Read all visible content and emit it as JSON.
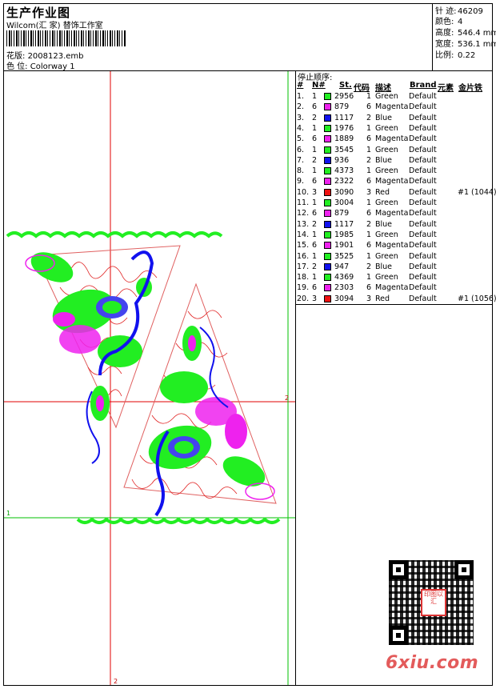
{
  "header": {
    "title": "生产作业图",
    "studio": "Wilcom(汇 家) 替饰工作室",
    "design_label": "花版:",
    "design_value": "2008123.emb",
    "colorway_label": "色 位:",
    "colorway_value": "Colorway 1"
  },
  "stats": [
    {
      "label": "针 迹:",
      "value": "46209"
    },
    {
      "label": "颜色:",
      "value": "4"
    },
    {
      "label": "高度:",
      "value": "546.4 mm"
    },
    {
      "label": "宽度:",
      "value": "536.1 mm"
    },
    {
      "label": "比例:",
      "value": "0.22"
    }
  ],
  "sequence": {
    "title": "停止顺序:",
    "headers": {
      "num": "#",
      "n": "N#",
      "st": "St.",
      "code": "代码",
      "desc": "描述",
      "brand": "Brand",
      "elem": "元素",
      "sequin": "金片铁"
    },
    "rows": [
      {
        "num": "1.",
        "n": "1",
        "color": "#22ee22",
        "st": "2956",
        "code": "1",
        "desc": "Green",
        "brand": "Default",
        "note": ""
      },
      {
        "num": "2.",
        "n": "6",
        "color": "#ee22ee",
        "st": "879",
        "code": "6",
        "desc": "Magenta",
        "brand": "Default",
        "note": ""
      },
      {
        "num": "3.",
        "n": "2",
        "color": "#1111ee",
        "st": "1117",
        "code": "2",
        "desc": "Blue",
        "brand": "Default",
        "note": ""
      },
      {
        "num": "4.",
        "n": "1",
        "color": "#22ee22",
        "st": "1976",
        "code": "1",
        "desc": "Green",
        "brand": "Default",
        "note": ""
      },
      {
        "num": "5.",
        "n": "6",
        "color": "#ee22ee",
        "st": "1889",
        "code": "6",
        "desc": "Magenta",
        "brand": "Default",
        "note": ""
      },
      {
        "num": "6.",
        "n": "1",
        "color": "#22ee22",
        "st": "3545",
        "code": "1",
        "desc": "Green",
        "brand": "Default",
        "note": ""
      },
      {
        "num": "7.",
        "n": "2",
        "color": "#1111ee",
        "st": "936",
        "code": "2",
        "desc": "Blue",
        "brand": "Default",
        "note": ""
      },
      {
        "num": "8.",
        "n": "1",
        "color": "#22ee22",
        "st": "4373",
        "code": "1",
        "desc": "Green",
        "brand": "Default",
        "note": ""
      },
      {
        "num": "9.",
        "n": "6",
        "color": "#ee22ee",
        "st": "2322",
        "code": "6",
        "desc": "Magenta",
        "brand": "Default",
        "note": ""
      },
      {
        "num": "10.",
        "n": "3",
        "color": "#ee1111",
        "st": "3090",
        "code": "3",
        "desc": "Red",
        "brand": "Default",
        "note": "#1 (1044)"
      },
      {
        "num": "11.",
        "n": "1",
        "color": "#22ee22",
        "st": "3004",
        "code": "1",
        "desc": "Green",
        "brand": "Default",
        "note": ""
      },
      {
        "num": "12.",
        "n": "6",
        "color": "#ee22ee",
        "st": "879",
        "code": "6",
        "desc": "Magenta",
        "brand": "Default",
        "note": ""
      },
      {
        "num": "13.",
        "n": "2",
        "color": "#1111ee",
        "st": "1117",
        "code": "2",
        "desc": "Blue",
        "brand": "Default",
        "note": ""
      },
      {
        "num": "14.",
        "n": "1",
        "color": "#22ee22",
        "st": "1985",
        "code": "1",
        "desc": "Green",
        "brand": "Default",
        "note": ""
      },
      {
        "num": "15.",
        "n": "6",
        "color": "#ee22ee",
        "st": "1901",
        "code": "6",
        "desc": "Magenta",
        "brand": "Default",
        "note": ""
      },
      {
        "num": "16.",
        "n": "1",
        "color": "#22ee22",
        "st": "3525",
        "code": "1",
        "desc": "Green",
        "brand": "Default",
        "note": ""
      },
      {
        "num": "17.",
        "n": "2",
        "color": "#1111ee",
        "st": "947",
        "code": "2",
        "desc": "Blue",
        "brand": "Default",
        "note": ""
      },
      {
        "num": "18.",
        "n": "1",
        "color": "#22ee22",
        "st": "4369",
        "code": "1",
        "desc": "Green",
        "brand": "Default",
        "note": ""
      },
      {
        "num": "19.",
        "n": "6",
        "color": "#ee22ee",
        "st": "2303",
        "code": "6",
        "desc": "Magenta",
        "brand": "Default",
        "note": ""
      },
      {
        "num": "20.",
        "n": "3",
        "color": "#ee1111",
        "st": "3094",
        "code": "3",
        "desc": "Red",
        "brand": "Default",
        "note": "#1 (1056)"
      }
    ]
  },
  "canvas": {
    "marker_1": "1",
    "marker_2": "2",
    "marker_3": "2"
  },
  "qr_stamp": "印图以汇",
  "watermark": "6xiu.com",
  "colors": {
    "green": "#22ee22",
    "magenta": "#ee22ee",
    "blue": "#1111ee",
    "red": "#ee1111"
  }
}
